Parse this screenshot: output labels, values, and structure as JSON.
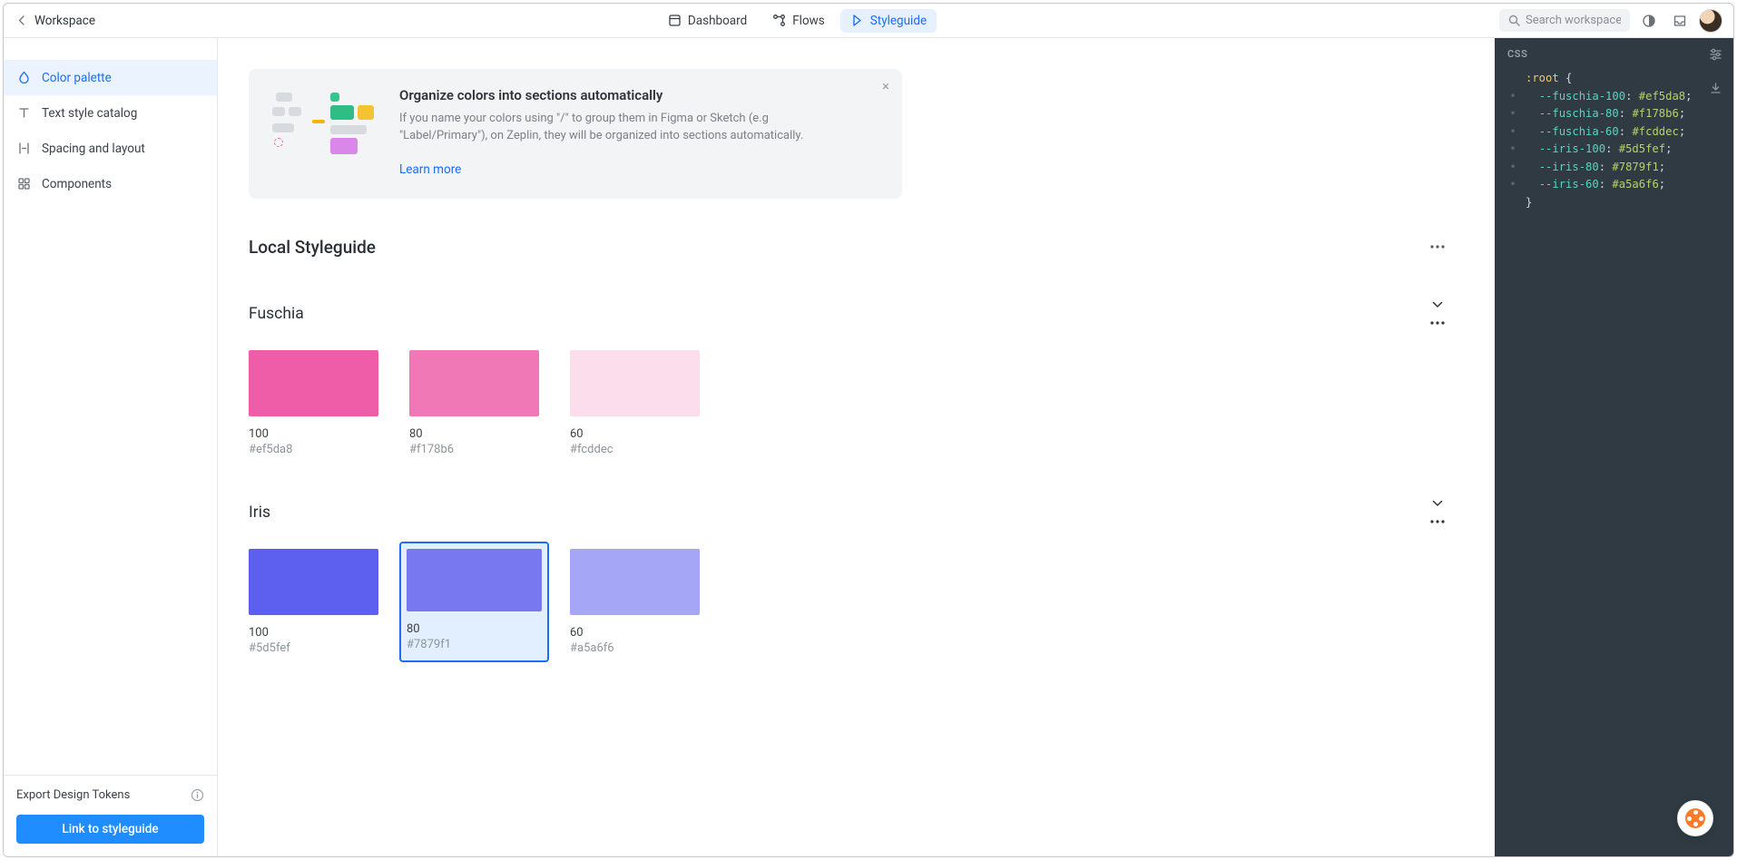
{
  "topbar": {
    "back_label": "Workspace",
    "tabs": [
      {
        "id": "dashboard",
        "label": "Dashboard"
      },
      {
        "id": "flows",
        "label": "Flows"
      },
      {
        "id": "styleguide",
        "label": "Styleguide"
      }
    ],
    "active_tab": "styleguide",
    "search_placeholder": "Search workspace"
  },
  "sidebar": {
    "items": [
      {
        "id": "color-palette",
        "label": "Color palette"
      },
      {
        "id": "text-styles",
        "label": "Text style catalog"
      },
      {
        "id": "spacing-layout",
        "label": "Spacing and layout"
      },
      {
        "id": "components",
        "label": "Components"
      }
    ],
    "active": "color-palette",
    "export_label": "Export Design Tokens",
    "link_btn_label": "Link to styleguide"
  },
  "banner": {
    "title": "Organize colors into sections automatically",
    "text": "If you name your colors using \"/\" to group them in Figma or Sketch (e.g \"Label/Primary\"), on Zeplin, they will be organized into sections automatically.",
    "link_label": "Learn more"
  },
  "styleguide": {
    "title": "Local Styleguide",
    "groups": [
      {
        "name": "Fuschia",
        "swatches": [
          {
            "name": "100",
            "hex": "#ef5da8"
          },
          {
            "name": "80",
            "hex": "#f178b6"
          },
          {
            "name": "60",
            "hex": "#fcddec"
          }
        ],
        "selected": null
      },
      {
        "name": "Iris",
        "swatches": [
          {
            "name": "100",
            "hex": "#5d5fef"
          },
          {
            "name": "80",
            "hex": "#7879f1"
          },
          {
            "name": "60",
            "hex": "#a5a6f6"
          }
        ],
        "selected": 1
      }
    ]
  },
  "code_panel": {
    "language": "CSS",
    "tokens": [
      {
        "name": "--fuschia-100",
        "value": "#ef5da8"
      },
      {
        "name": "--fuschia-80",
        "value": "#f178b6"
      },
      {
        "name": "--fuschia-60",
        "value": "#fcddec"
      },
      {
        "name": "--iris-100",
        "value": "#5d5fef"
      },
      {
        "name": "--iris-80",
        "value": "#7879f1"
      },
      {
        "name": "--iris-60",
        "value": "#a5a6f6"
      }
    ]
  }
}
